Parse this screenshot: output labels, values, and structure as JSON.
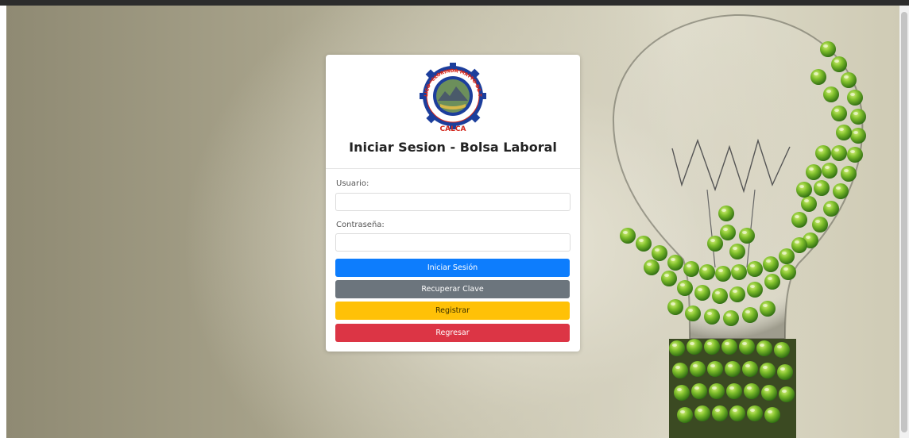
{
  "login": {
    "title": "Iniciar Sesion - Bolsa Laboral",
    "username_label": "Usuario:",
    "username_value": "",
    "password_label": "Contraseña:",
    "password_value": "",
    "buttons": {
      "login": "Iniciar Sesión",
      "recover": "Recuperar Clave",
      "register": "Registrar",
      "back": "Regresar"
    }
  },
  "logo": {
    "ring_text": "IES PUBLICO \"CLORINDA MATTO DE TURNER\"",
    "bottom_text": "CALCA"
  },
  "colors": {
    "login_button": "#0d7dfd",
    "recover_button": "#6c757d",
    "register_button": "#ffc107",
    "back_button": "#dc3545",
    "logo_ring": "#1c3e9c",
    "logo_text": "#d3281d"
  },
  "icons": {
    "logo": "institution-gear-seal",
    "background_art": "lightbulb-made-of-green-apples"
  }
}
